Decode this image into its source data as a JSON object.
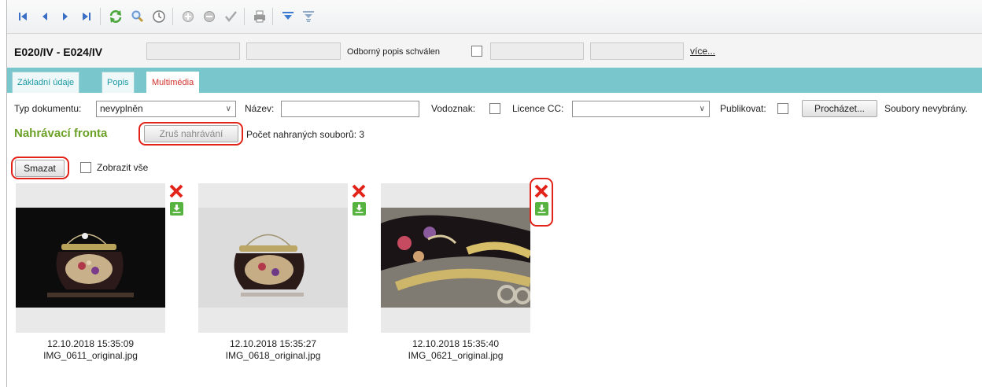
{
  "toolbar": {
    "icons": [
      "first-record-icon",
      "previous-record-icon",
      "next-record-icon",
      "last-record-icon",
      "refresh-icon",
      "search-icon",
      "clock-icon",
      "add-icon",
      "remove-icon",
      "confirm-icon",
      "print-icon",
      "filter-icon",
      "filter-clear-icon"
    ]
  },
  "record": {
    "title": "E020/IV - E024/IV",
    "approved_label": "Odborný popis schválen",
    "more_link": "více..."
  },
  "tabs": [
    {
      "label": "Základní údaje",
      "active": false
    },
    {
      "label": "Popis",
      "active": false
    },
    {
      "label": "Multimédia",
      "active": true
    }
  ],
  "form": {
    "doc_type_label": "Typ dokumentu:",
    "doc_type_value": "nevyplněn",
    "name_label": "Název:",
    "name_value": "",
    "watermark_label": "Vodoznak:",
    "license_label": "Licence CC:",
    "license_value": "",
    "publish_label": "Publikovat:",
    "browse_button": "Procházet...",
    "files_status": "Soubory nevybrány."
  },
  "queue": {
    "title": "Nahrávací fronta",
    "cancel_button": "Zruš nahrávání",
    "count_text": "Počet nahraných souborů: 3",
    "delete_button": "Smazat",
    "show_all_label": "Zobrazit vše"
  },
  "thumbnails": [
    {
      "timestamp": "12.10.2018 15:35:09",
      "filename": "IMG_0611_original.jpg"
    },
    {
      "timestamp": "12.10.2018 15:35:27",
      "filename": "IMG_0618_original.jpg"
    },
    {
      "timestamp": "12.10.2018 15:35:40",
      "filename": "IMG_0621_original.jpg"
    }
  ],
  "colors": {
    "tab_strip": "#79c6cd",
    "active_tab_text": "#d2322d",
    "queue_title": "#6aa126",
    "highlight_ring": "#e2231a",
    "delete_icon": "#e2231a",
    "download_icon": "#56b33f"
  }
}
